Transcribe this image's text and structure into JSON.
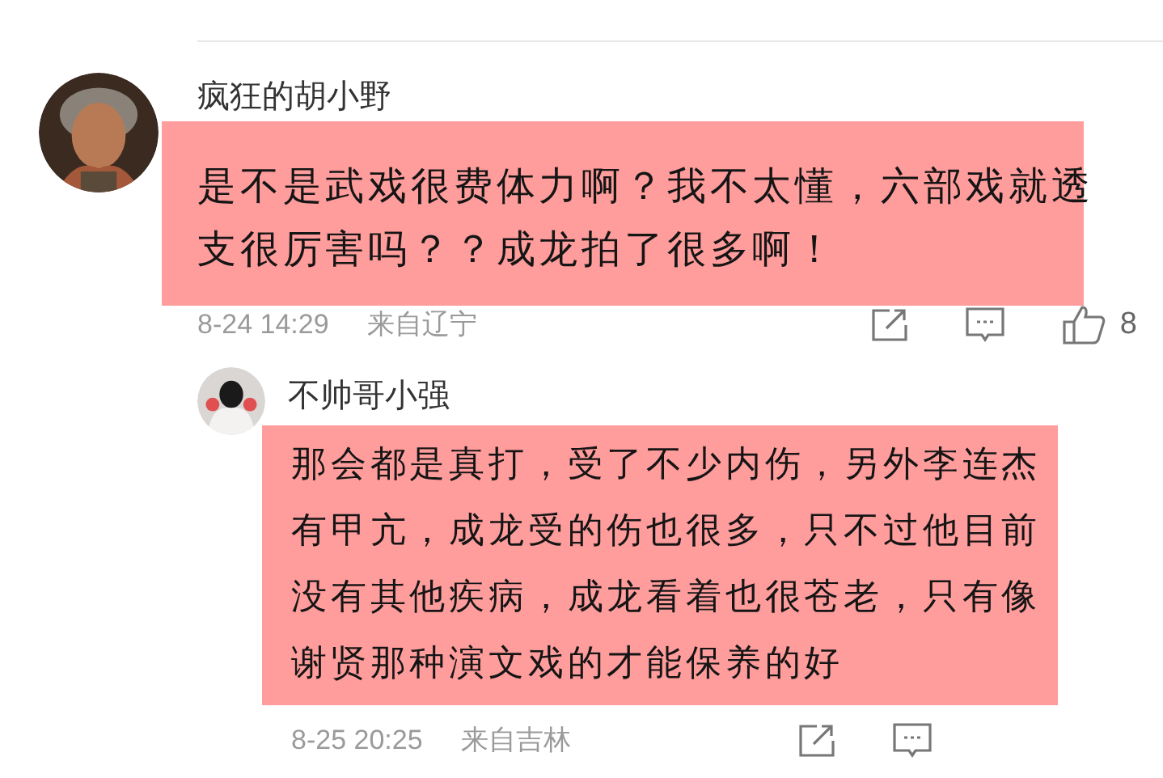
{
  "comments": [
    {
      "user": "疯狂的胡小野",
      "text": "是不是武戏很费体力啊？我不太懂，六部戏就透支很厉害吗？？成龙拍了很多啊！",
      "time": "8-24 14:29",
      "location": "来自辽宁",
      "likes": "8",
      "highlighted": true,
      "replies": [
        {
          "user": "不帅哥小强",
          "text": "那会都是真打，受了不少内伤，另外李连杰有甲亢，成龙受的伤也很多，只不过他目前没有其他疾病，成龙看着也很苍老，只有像谢贤那种演文戏的才能保养的好",
          "time": "8-25 20:25",
          "location": "来自吉林",
          "highlighted": true
        }
      ]
    }
  ]
}
